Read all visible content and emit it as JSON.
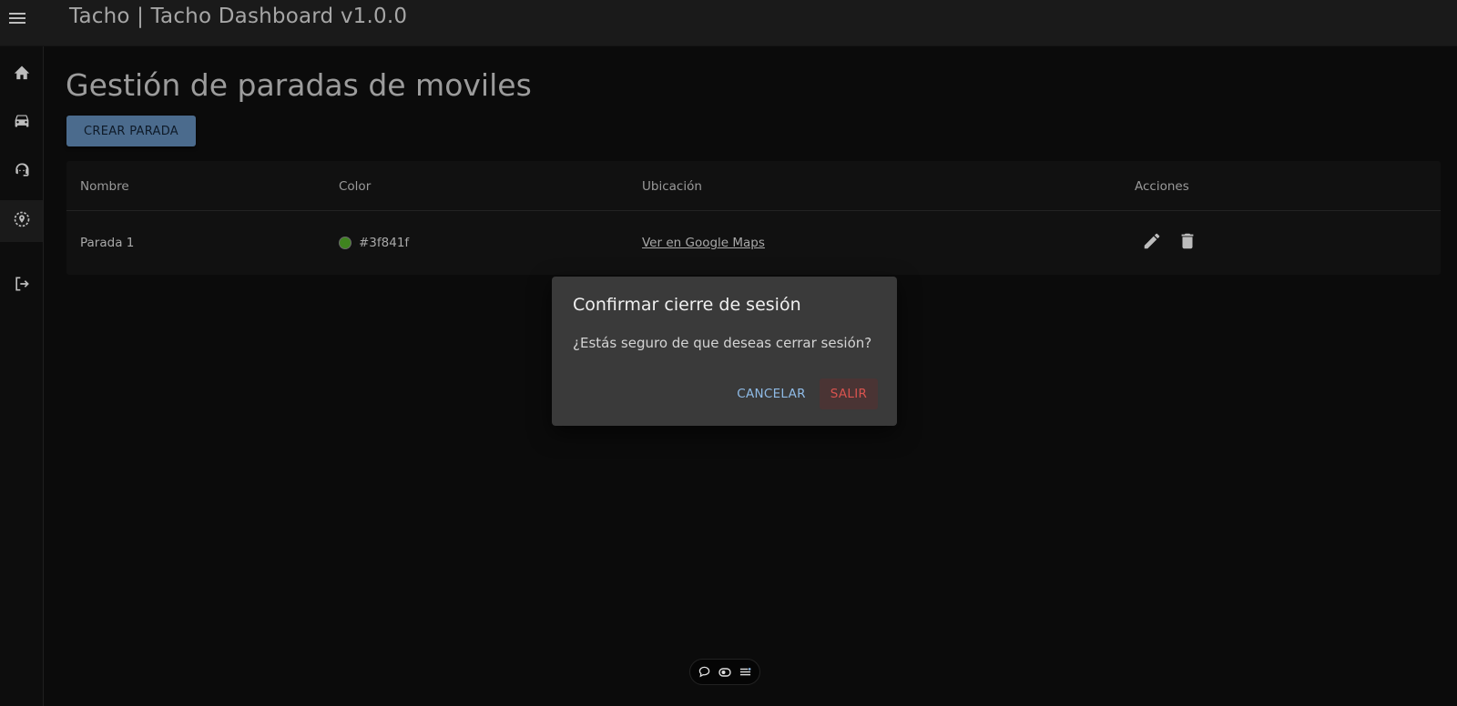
{
  "app": {
    "title": "Tacho | Tacho Dashboard v1.0.0"
  },
  "sidebar": {
    "items": [
      {
        "icon": "home-icon",
        "active": false
      },
      {
        "icon": "car-icon",
        "active": false
      },
      {
        "icon": "support-agent-icon",
        "active": false
      },
      {
        "icon": "location-stop-icon",
        "active": true
      },
      {
        "icon": "logout-icon",
        "active": false
      }
    ]
  },
  "main": {
    "title": "Gestión de paradas de moviles",
    "create_button": "CREAR PARADA",
    "table": {
      "headers": [
        "Nombre",
        "Color",
        "Ubicación",
        "Acciones"
      ],
      "rows": [
        {
          "name": "Parada 1",
          "color": "#3f841f",
          "location_link": "Ver en Google Maps"
        }
      ]
    }
  },
  "dialog": {
    "title": "Confirmar cierre de sesión",
    "message": "¿Estás seguro de que deseas cerrar sesión?",
    "cancel": "CANCELAR",
    "confirm": "SALIR"
  },
  "colors": {
    "accent": "#4b6b8d",
    "danger": "#d9534f",
    "link": "#8fbbe6"
  }
}
